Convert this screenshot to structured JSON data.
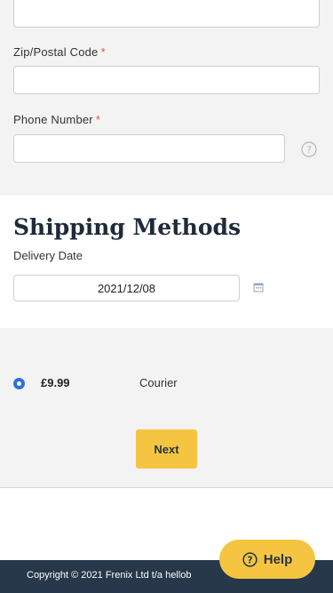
{
  "form": {
    "zip": {
      "label": "Zip/Postal Code",
      "required_mark": "*",
      "value": ""
    },
    "phone": {
      "label": "Phone Number",
      "required_mark": "*",
      "value": "",
      "help_icon": "question-circle-icon"
    }
  },
  "shipping": {
    "title": "Shipping Methods",
    "delivery_label": "Delivery Date",
    "delivery_date": "2021/12/08",
    "calendar_icon": "calendar-icon",
    "option": {
      "price": "£9.99",
      "name": "Courier",
      "selected": true
    }
  },
  "actions": {
    "next_label": "Next"
  },
  "footer": {
    "copyright": "Copyright © 2021 Frenix Ltd t/a hellob"
  },
  "help": {
    "label": "Help",
    "icon": "question-circle-icon"
  },
  "colors": {
    "accent": "#f5c542",
    "footer_bg": "#27384a",
    "radio": "#2f6fe0"
  }
}
